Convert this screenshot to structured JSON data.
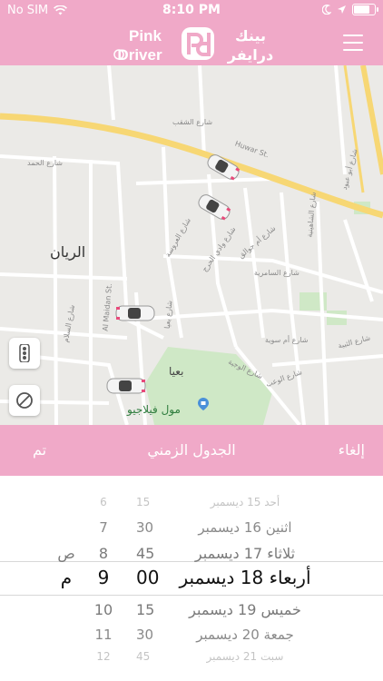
{
  "status_bar": {
    "carrier": "No SIM",
    "time": "8:10 PM",
    "battery_fraction": 0.85
  },
  "header": {
    "logo_text_en_line1": "Pink",
    "logo_text_en_line2": "Driver",
    "logo_text_ar_line1": "بينك",
    "logo_text_ar_line2": "درايفر"
  },
  "map": {
    "labels": [
      {
        "text": "الريان",
        "style": "big"
      },
      {
        "text": "Huwar St.",
        "style": "small"
      },
      {
        "text": "Al Maidan St.",
        "style": "small"
      },
      {
        "text": "بعيا",
        "style": "mid"
      },
      {
        "text": "مول فيلاجيو",
        "style": "green"
      },
      {
        "text": "شارع الشقب",
        "style": "small"
      },
      {
        "text": "شارع الحمد",
        "style": "small"
      },
      {
        "text": "شارع السلام",
        "style": "small"
      },
      {
        "text": "شارع الشاهينية",
        "style": "small"
      },
      {
        "text": "شارع السامرية",
        "style": "small"
      },
      {
        "text": "شارع أم سوية",
        "style": "small"
      },
      {
        "text": "شارع الوعب",
        "style": "small"
      },
      {
        "text": "شارع الوجبة",
        "style": "small"
      },
      {
        "text": "شارع العروسة",
        "style": "small"
      },
      {
        "text": "شارع وادي الحرج",
        "style": "small"
      },
      {
        "text": "شارع أم جوالق",
        "style": "small"
      },
      {
        "text": "شارع أبو عبود",
        "style": "small"
      },
      {
        "text": "شارع الثبية",
        "style": "small"
      },
      {
        "text": "شارع بعيا",
        "style": "small"
      }
    ],
    "colors": {
      "land": "#ebeae7",
      "road": "#ffffff",
      "highway": "#f7d774",
      "park": "#cfe8c6"
    }
  },
  "toolbar": {
    "cancel": "إلغاء",
    "title": "الجدول الزمني",
    "done": "تم"
  },
  "picker": {
    "rows": [
      {
        "date": "أحد 15 ديسمبر",
        "minute": "15",
        "hour": "6",
        "ampm": ""
      },
      {
        "date": "اثنين 16 ديسمبر",
        "minute": "30",
        "hour": "7",
        "ampm": ""
      },
      {
        "date": "ثلاثاء 17 ديسمبر",
        "minute": "45",
        "hour": "8",
        "ampm": "ص"
      },
      {
        "date": "أربعاء 18 ديسمبر",
        "minute": "00",
        "hour": "9",
        "ampm": "م",
        "selected": true
      },
      {
        "date": "خميس 19 ديسمبر",
        "minute": "15",
        "hour": "10",
        "ampm": ""
      },
      {
        "date": "جمعة 20 ديسمبر",
        "minute": "30",
        "hour": "11",
        "ampm": ""
      },
      {
        "date": "سبت 21 ديسمبر",
        "minute": "45",
        "hour": "12",
        "ampm": ""
      }
    ]
  },
  "colors": {
    "brand_pink": "#f0a9c8",
    "white": "#ffffff",
    "map_button_bg": "#ffffff"
  }
}
